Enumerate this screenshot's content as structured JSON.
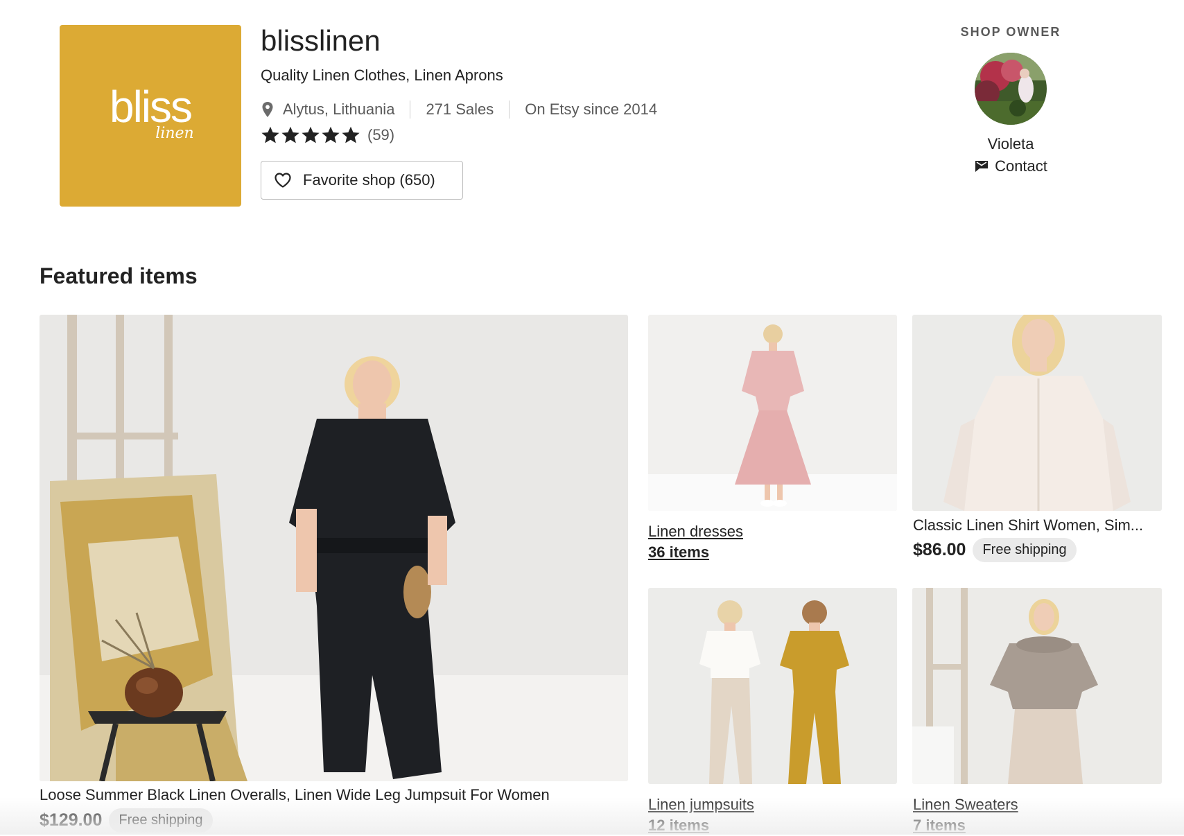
{
  "shop": {
    "logo_word": "bliss",
    "logo_sub": "linen",
    "logo_color": "#dcaa34",
    "name": "blisslinen",
    "tagline": "Quality Linen Clothes, Linen Aprons",
    "location": "Alytus, Lithuania",
    "sales": "271 Sales",
    "since": "On Etsy since 2014",
    "rating": 5,
    "reviews": "(59)",
    "favorite_label": "Favorite shop (650)"
  },
  "owner": {
    "heading": "SHOP OWNER",
    "name": "Violeta",
    "contact_label": "Contact"
  },
  "featured": {
    "title": "Featured items",
    "main_item": {
      "title": "Loose Summer Black Linen Overalls, Linen Wide Leg Jumpsuit For Women",
      "price": "$129.00",
      "shipping": "Free shipping"
    },
    "shirt_item": {
      "title": "Classic Linen Shirt Women, Sim...",
      "price": "$86.00",
      "shipping": "Free shipping"
    },
    "sections": [
      {
        "name": "Linen dresses",
        "count": "36 items"
      },
      {
        "name": "Linen jumpsuits",
        "count": "12 items"
      },
      {
        "name": "Linen Sweaters",
        "count": "7 items"
      }
    ]
  },
  "icons": {
    "location": "map-pin-icon",
    "star": "star-icon",
    "favorite": "heart-icon",
    "contact": "message-icon"
  },
  "colors": {
    "text": "#222222",
    "muted": "#595959",
    "badge_bg": "#eaeaea"
  }
}
